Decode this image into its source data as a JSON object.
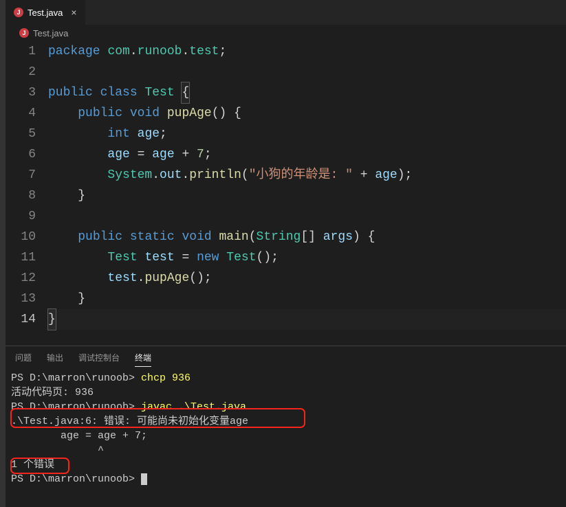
{
  "tab": {
    "filename": "Test.java",
    "iconLetter": "J"
  },
  "breadcrumb": {
    "filename": "Test.java",
    "iconLetter": "J"
  },
  "editor": {
    "activeLine": 14,
    "lines": [
      {
        "n": 1,
        "tokens": [
          [
            "kw",
            "package"
          ],
          [
            "punc",
            " "
          ],
          [
            "cls",
            "com"
          ],
          [
            "punc",
            "."
          ],
          [
            "cls",
            "runoob"
          ],
          [
            "punc",
            "."
          ],
          [
            "cls",
            "test"
          ],
          [
            "punc",
            ";"
          ]
        ]
      },
      {
        "n": 2,
        "tokens": []
      },
      {
        "n": 3,
        "tokens": [
          [
            "kw",
            "public"
          ],
          [
            "punc",
            " "
          ],
          [
            "kw",
            "class"
          ],
          [
            "punc",
            " "
          ],
          [
            "cls",
            "Test"
          ],
          [
            "punc",
            " "
          ],
          [
            "brace",
            "{"
          ]
        ]
      },
      {
        "n": 4,
        "tokens": [
          [
            "punc",
            "    "
          ],
          [
            "kw",
            "public"
          ],
          [
            "punc",
            " "
          ],
          [
            "kw",
            "void"
          ],
          [
            "punc",
            " "
          ],
          [
            "fn",
            "pupAge"
          ],
          [
            "punc",
            "() {"
          ]
        ]
      },
      {
        "n": 5,
        "tokens": [
          [
            "punc",
            "        "
          ],
          [
            "kw",
            "int"
          ],
          [
            "punc",
            " "
          ],
          [
            "var",
            "age"
          ],
          [
            "punc",
            ";"
          ]
        ]
      },
      {
        "n": 6,
        "tokens": [
          [
            "punc",
            "        "
          ],
          [
            "var",
            "age"
          ],
          [
            "punc",
            " = "
          ],
          [
            "var",
            "age"
          ],
          [
            "punc",
            " + "
          ],
          [
            "num",
            "7"
          ],
          [
            "punc",
            ";"
          ]
        ]
      },
      {
        "n": 7,
        "tokens": [
          [
            "punc",
            "        "
          ],
          [
            "cls",
            "System"
          ],
          [
            "punc",
            "."
          ],
          [
            "var",
            "out"
          ],
          [
            "punc",
            "."
          ],
          [
            "fn",
            "println"
          ],
          [
            "punc",
            "("
          ],
          [
            "str",
            "\"小狗的年龄是: \""
          ],
          [
            "punc",
            " + "
          ],
          [
            "var",
            "age"
          ],
          [
            "punc",
            ");"
          ]
        ]
      },
      {
        "n": 8,
        "tokens": [
          [
            "punc",
            "    }"
          ]
        ]
      },
      {
        "n": 9,
        "tokens": []
      },
      {
        "n": 10,
        "tokens": [
          [
            "punc",
            "    "
          ],
          [
            "kw",
            "public"
          ],
          [
            "punc",
            " "
          ],
          [
            "kw",
            "static"
          ],
          [
            "punc",
            " "
          ],
          [
            "kw",
            "void"
          ],
          [
            "punc",
            " "
          ],
          [
            "fn",
            "main"
          ],
          [
            "punc",
            "("
          ],
          [
            "cls",
            "String"
          ],
          [
            "punc",
            "[] "
          ],
          [
            "var",
            "args"
          ],
          [
            "punc",
            ") {"
          ]
        ]
      },
      {
        "n": 11,
        "tokens": [
          [
            "punc",
            "        "
          ],
          [
            "cls",
            "Test"
          ],
          [
            "punc",
            " "
          ],
          [
            "var",
            "test"
          ],
          [
            "punc",
            " = "
          ],
          [
            "kw",
            "new"
          ],
          [
            "punc",
            " "
          ],
          [
            "cls",
            "Test"
          ],
          [
            "punc",
            "();"
          ]
        ]
      },
      {
        "n": 12,
        "tokens": [
          [
            "punc",
            "        "
          ],
          [
            "var",
            "test"
          ],
          [
            "punc",
            "."
          ],
          [
            "fn",
            "pupAge"
          ],
          [
            "punc",
            "();"
          ]
        ]
      },
      {
        "n": 13,
        "tokens": [
          [
            "punc",
            "    }"
          ]
        ]
      },
      {
        "n": 14,
        "tokens": [
          [
            "brace",
            "}"
          ]
        ]
      }
    ]
  },
  "panel": {
    "tabs": [
      "问题",
      "输出",
      "调试控制台",
      "终端"
    ],
    "activeTab": 3,
    "terminal": {
      "lines": [
        {
          "segments": [
            [
              "prompt",
              "PS D:\\marron\\runoob> "
            ],
            [
              "cmd",
              "chcp 936"
            ]
          ]
        },
        {
          "segments": [
            [
              "out",
              "活动代码页: 936"
            ]
          ]
        },
        {
          "segments": [
            [
              "prompt",
              "PS D:\\marron\\runoob> "
            ],
            [
              "cmd",
              "javac .\\Test.java"
            ]
          ]
        },
        {
          "segments": [
            [
              "out",
              ".\\Test.java:6: 错误: 可能尚未初始化变量age"
            ]
          ]
        },
        {
          "segments": [
            [
              "out",
              "        age = age + 7;"
            ]
          ]
        },
        {
          "segments": [
            [
              "out",
              "              ^"
            ]
          ]
        },
        {
          "segments": [
            [
              "out",
              "1 个错误"
            ]
          ]
        },
        {
          "segments": [
            [
              "prompt",
              "PS D:\\marron\\runoob> "
            ],
            [
              "cursor",
              ""
            ]
          ]
        }
      ]
    }
  }
}
